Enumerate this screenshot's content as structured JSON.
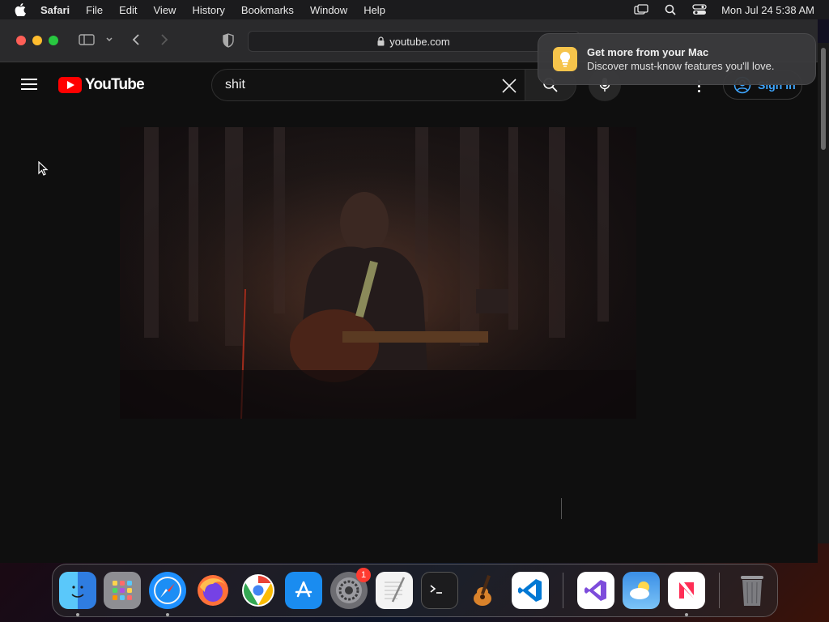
{
  "menubar": {
    "app": "Safari",
    "items": [
      "File",
      "Edit",
      "View",
      "History",
      "Bookmarks",
      "Window",
      "Help"
    ],
    "clock": "Mon Jul 24  5:38 AM",
    "icons": [
      "apple-icon",
      "screen-mirroring-icon",
      "search-icon",
      "control-center-icon"
    ]
  },
  "browser": {
    "url": "youtube.com",
    "icons": [
      "sidebar-icon",
      "chevron-down-icon",
      "back-icon",
      "forward-icon",
      "shield-icon",
      "lock-icon"
    ]
  },
  "youtube": {
    "logo_text": "YouTube",
    "search_value": "shit",
    "sign_in": "Sign in",
    "accent": "#ff0000",
    "link_color": "#3ea6ff"
  },
  "notification": {
    "title": "Get more from your Mac",
    "body": "Discover must-know features you'll love."
  },
  "dock": {
    "apps": [
      "Finder",
      "Launchpad",
      "Safari",
      "Firefox",
      "Chrome",
      "App Store",
      "System Settings",
      "TextEdit",
      "Terminal",
      "GarageBand",
      "VS Code",
      "Visual Studio",
      "Weather",
      "News",
      "Trash"
    ],
    "settings_badge": "1"
  }
}
